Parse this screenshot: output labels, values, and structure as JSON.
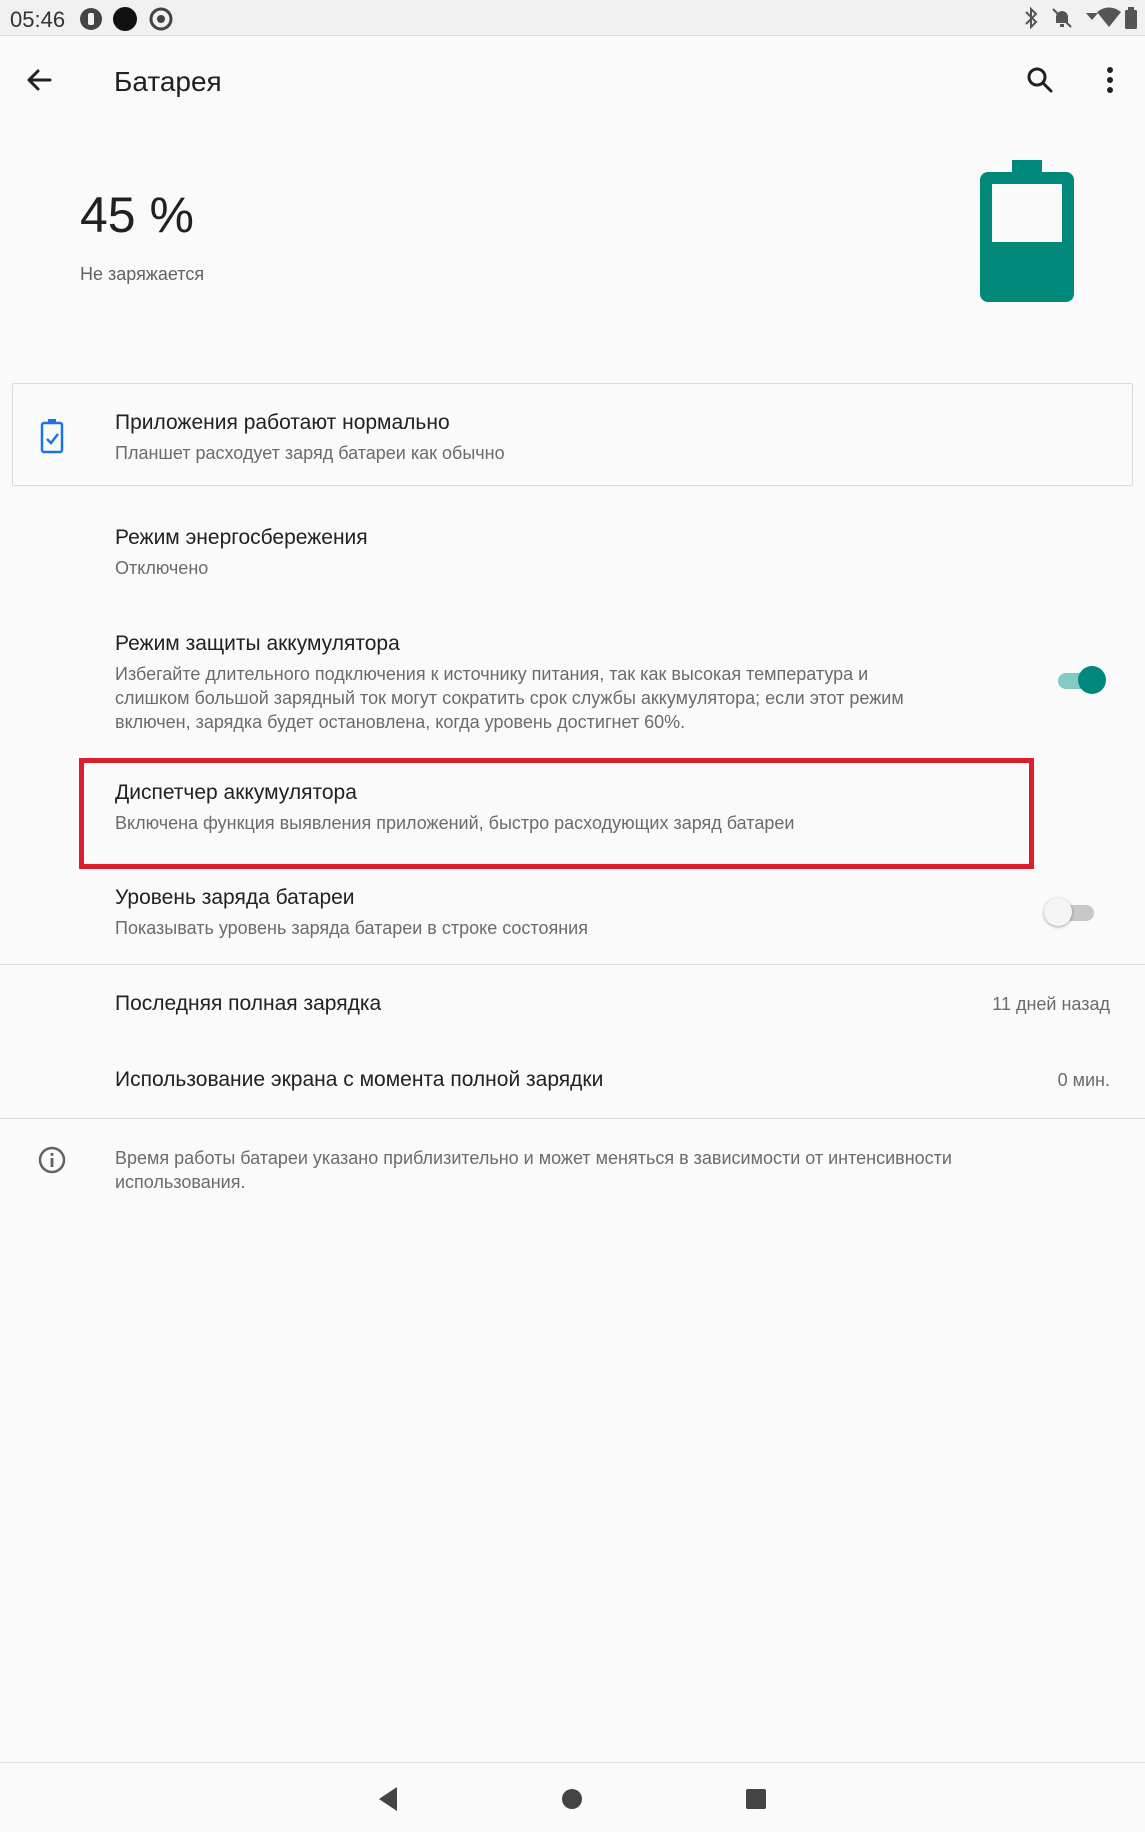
{
  "status_bar": {
    "time": "05:46",
    "icons": [
      "notification-icon",
      "circle-icon",
      "sync-icon",
      "bluetooth-icon",
      "dnd-off-icon",
      "wifi-icon",
      "battery-icon"
    ]
  },
  "header": {
    "title": "Батарея",
    "back_icon": "arrow-left-icon",
    "search_icon": "search-icon",
    "menu_icon": "more-vert-icon"
  },
  "battery": {
    "percent_text": "45 %",
    "level": 0.45,
    "status": "Не заряжается",
    "color": "#00897b"
  },
  "tip_card": {
    "title": "Приложения работают нормально",
    "subtitle": "Планшет расходует заряд батареи как обычно",
    "icon": "battery-check-icon",
    "icon_color": "#1a73e8"
  },
  "settings": {
    "power_saving": {
      "title": "Режим энергосбережения",
      "subtitle": "Отключено"
    },
    "battery_protection": {
      "title": "Режим защиты аккумулятора",
      "subtitle_lines": [
        "Избегайте длительного подключения к источнику питания, так как высокая температура и",
        "слишком большой зарядный ток могут сократить срок службы аккумулятора; если этот режим",
        "включен, зарядка будет остановлена, когда уровень достигнет 60%."
      ],
      "enabled": true
    },
    "battery_manager": {
      "title": "Диспетчер аккумулятора",
      "subtitle": "Включена функция выявления приложений, быстро расходующих заряд батареи"
    },
    "battery_percentage": {
      "title": "Уровень заряда батареи",
      "subtitle": "Показывать уровень заряда батареи в строке состояния",
      "enabled": false
    }
  },
  "usage": {
    "last_full_charge": {
      "label": "Последняя полная зарядка",
      "value": "11 дней назад"
    },
    "screen_usage": {
      "label": "Использование экрана с момента полной зарядки",
      "value": "0 мин."
    }
  },
  "footer_note": {
    "icon": "info-icon",
    "lines": [
      "Время работы батареи указано приблизительно и может меняться в зависимости от интенсивности",
      "использования."
    ]
  },
  "colors": {
    "accent": "#00897b",
    "highlight": "#dc1f2c"
  },
  "nav_bar": {
    "back": "nav-back-icon",
    "home": "nav-home-icon",
    "recents": "nav-recents-icon"
  }
}
